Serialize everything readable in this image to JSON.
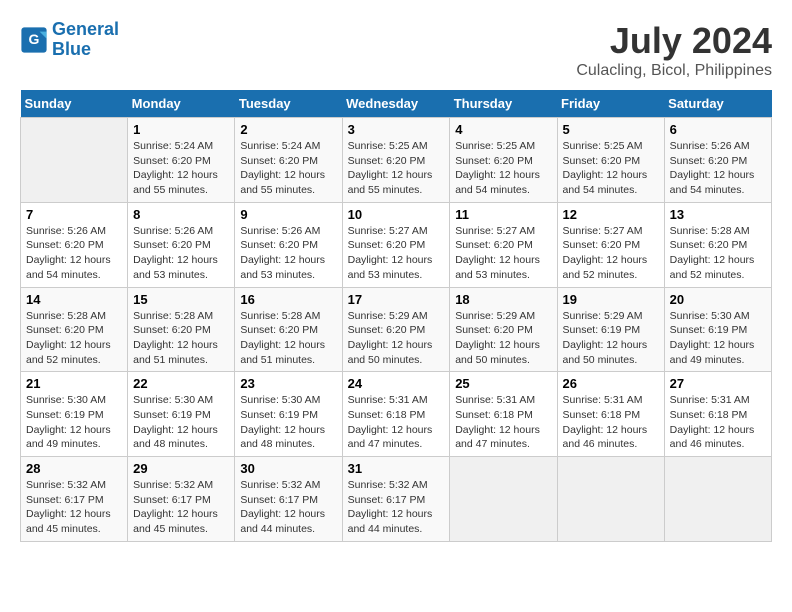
{
  "header": {
    "logo_line1": "General",
    "logo_line2": "Blue",
    "title": "July 2024",
    "subtitle": "Culacling, Bicol, Philippines"
  },
  "columns": [
    "Sunday",
    "Monday",
    "Tuesday",
    "Wednesday",
    "Thursday",
    "Friday",
    "Saturday"
  ],
  "weeks": [
    [
      {
        "num": "",
        "info": ""
      },
      {
        "num": "1",
        "info": "Sunrise: 5:24 AM\nSunset: 6:20 PM\nDaylight: 12 hours\nand 55 minutes."
      },
      {
        "num": "2",
        "info": "Sunrise: 5:24 AM\nSunset: 6:20 PM\nDaylight: 12 hours\nand 55 minutes."
      },
      {
        "num": "3",
        "info": "Sunrise: 5:25 AM\nSunset: 6:20 PM\nDaylight: 12 hours\nand 55 minutes."
      },
      {
        "num": "4",
        "info": "Sunrise: 5:25 AM\nSunset: 6:20 PM\nDaylight: 12 hours\nand 54 minutes."
      },
      {
        "num": "5",
        "info": "Sunrise: 5:25 AM\nSunset: 6:20 PM\nDaylight: 12 hours\nand 54 minutes."
      },
      {
        "num": "6",
        "info": "Sunrise: 5:26 AM\nSunset: 6:20 PM\nDaylight: 12 hours\nand 54 minutes."
      }
    ],
    [
      {
        "num": "7",
        "info": "Sunrise: 5:26 AM\nSunset: 6:20 PM\nDaylight: 12 hours\nand 54 minutes."
      },
      {
        "num": "8",
        "info": "Sunrise: 5:26 AM\nSunset: 6:20 PM\nDaylight: 12 hours\nand 53 minutes."
      },
      {
        "num": "9",
        "info": "Sunrise: 5:26 AM\nSunset: 6:20 PM\nDaylight: 12 hours\nand 53 minutes."
      },
      {
        "num": "10",
        "info": "Sunrise: 5:27 AM\nSunset: 6:20 PM\nDaylight: 12 hours\nand 53 minutes."
      },
      {
        "num": "11",
        "info": "Sunrise: 5:27 AM\nSunset: 6:20 PM\nDaylight: 12 hours\nand 53 minutes."
      },
      {
        "num": "12",
        "info": "Sunrise: 5:27 AM\nSunset: 6:20 PM\nDaylight: 12 hours\nand 52 minutes."
      },
      {
        "num": "13",
        "info": "Sunrise: 5:28 AM\nSunset: 6:20 PM\nDaylight: 12 hours\nand 52 minutes."
      }
    ],
    [
      {
        "num": "14",
        "info": "Sunrise: 5:28 AM\nSunset: 6:20 PM\nDaylight: 12 hours\nand 52 minutes."
      },
      {
        "num": "15",
        "info": "Sunrise: 5:28 AM\nSunset: 6:20 PM\nDaylight: 12 hours\nand 51 minutes."
      },
      {
        "num": "16",
        "info": "Sunrise: 5:28 AM\nSunset: 6:20 PM\nDaylight: 12 hours\nand 51 minutes."
      },
      {
        "num": "17",
        "info": "Sunrise: 5:29 AM\nSunset: 6:20 PM\nDaylight: 12 hours\nand 50 minutes."
      },
      {
        "num": "18",
        "info": "Sunrise: 5:29 AM\nSunset: 6:20 PM\nDaylight: 12 hours\nand 50 minutes."
      },
      {
        "num": "19",
        "info": "Sunrise: 5:29 AM\nSunset: 6:19 PM\nDaylight: 12 hours\nand 50 minutes."
      },
      {
        "num": "20",
        "info": "Sunrise: 5:30 AM\nSunset: 6:19 PM\nDaylight: 12 hours\nand 49 minutes."
      }
    ],
    [
      {
        "num": "21",
        "info": "Sunrise: 5:30 AM\nSunset: 6:19 PM\nDaylight: 12 hours\nand 49 minutes."
      },
      {
        "num": "22",
        "info": "Sunrise: 5:30 AM\nSunset: 6:19 PM\nDaylight: 12 hours\nand 48 minutes."
      },
      {
        "num": "23",
        "info": "Sunrise: 5:30 AM\nSunset: 6:19 PM\nDaylight: 12 hours\nand 48 minutes."
      },
      {
        "num": "24",
        "info": "Sunrise: 5:31 AM\nSunset: 6:18 PM\nDaylight: 12 hours\nand 47 minutes."
      },
      {
        "num": "25",
        "info": "Sunrise: 5:31 AM\nSunset: 6:18 PM\nDaylight: 12 hours\nand 47 minutes."
      },
      {
        "num": "26",
        "info": "Sunrise: 5:31 AM\nSunset: 6:18 PM\nDaylight: 12 hours\nand 46 minutes."
      },
      {
        "num": "27",
        "info": "Sunrise: 5:31 AM\nSunset: 6:18 PM\nDaylight: 12 hours\nand 46 minutes."
      }
    ],
    [
      {
        "num": "28",
        "info": "Sunrise: 5:32 AM\nSunset: 6:17 PM\nDaylight: 12 hours\nand 45 minutes."
      },
      {
        "num": "29",
        "info": "Sunrise: 5:32 AM\nSunset: 6:17 PM\nDaylight: 12 hours\nand 45 minutes."
      },
      {
        "num": "30",
        "info": "Sunrise: 5:32 AM\nSunset: 6:17 PM\nDaylight: 12 hours\nand 44 minutes."
      },
      {
        "num": "31",
        "info": "Sunrise: 5:32 AM\nSunset: 6:17 PM\nDaylight: 12 hours\nand 44 minutes."
      },
      {
        "num": "",
        "info": ""
      },
      {
        "num": "",
        "info": ""
      },
      {
        "num": "",
        "info": ""
      }
    ]
  ]
}
